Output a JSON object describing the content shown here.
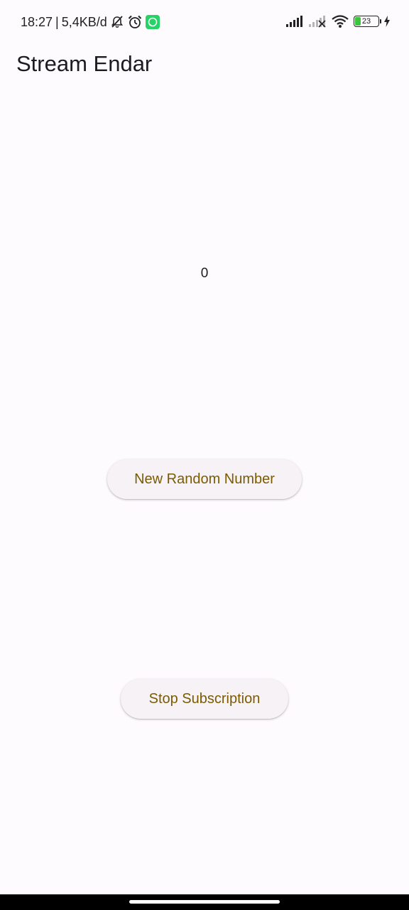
{
  "status_bar": {
    "time": "18:27",
    "separator": "|",
    "network_speed": "5,4KB/d",
    "left_icons": [
      "bell-off-icon",
      "alarm-icon",
      "whatsapp-icon"
    ],
    "right_icons": [
      "signal-icon",
      "signal-no-service-icon",
      "wifi-icon",
      "battery-icon",
      "charging-bolt-icon"
    ],
    "battery_level": "23",
    "battery_fraction": 0.23
  },
  "app_bar": {
    "title": "Stream Endar"
  },
  "main": {
    "number_value": "0",
    "new_random_button_label": "New Random Number",
    "stop_subscription_button_label": "Stop Subscription"
  },
  "colors": {
    "background": "#fefbff",
    "button_background": "#f7f2f6",
    "button_text": "#7b5b00",
    "whatsapp": "#25d366",
    "battery_fill": "#3cc43c"
  }
}
